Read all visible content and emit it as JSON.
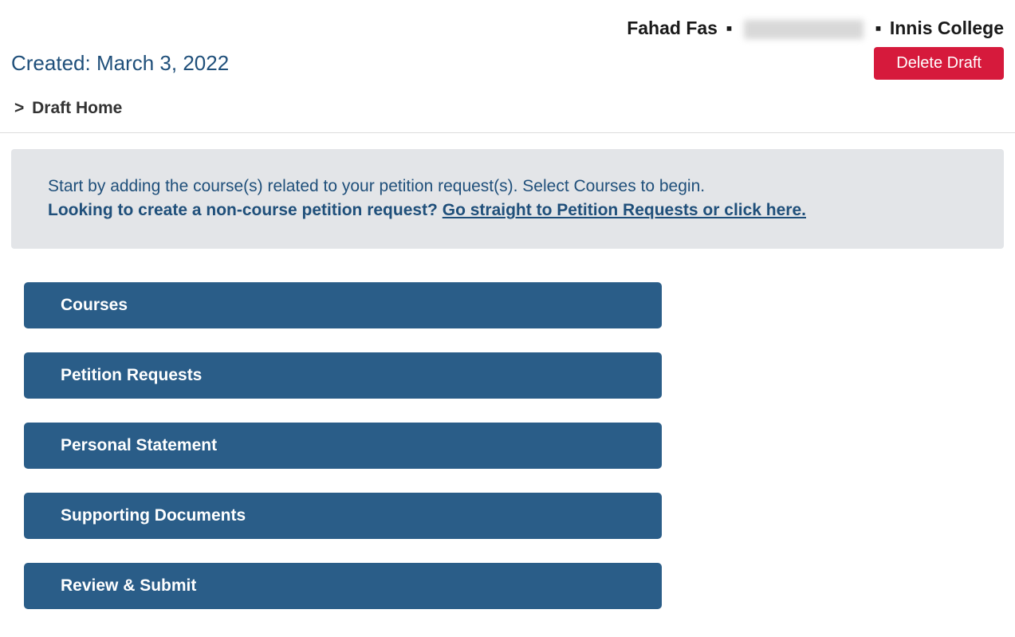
{
  "header": {
    "user_name": "Fahad Fas",
    "separator": "▪",
    "college": "Innis College"
  },
  "created": {
    "label": "Created: March 3, 2022"
  },
  "actions": {
    "delete_draft": "Delete Draft"
  },
  "breadcrumb": {
    "chevron": ">",
    "current": "Draft Home"
  },
  "infobox": {
    "line1": "Start by adding the course(s) related to your petition request(s). Select Courses to begin.",
    "line2_prefix": "Looking to create a non-course petition request? ",
    "line2_link": "Go straight to Petition Requests or click here."
  },
  "nav": {
    "items": [
      {
        "label": "Courses"
      },
      {
        "label": "Petition Requests"
      },
      {
        "label": "Personal Statement"
      },
      {
        "label": "Supporting Documents"
      },
      {
        "label": "Review & Submit"
      }
    ]
  }
}
